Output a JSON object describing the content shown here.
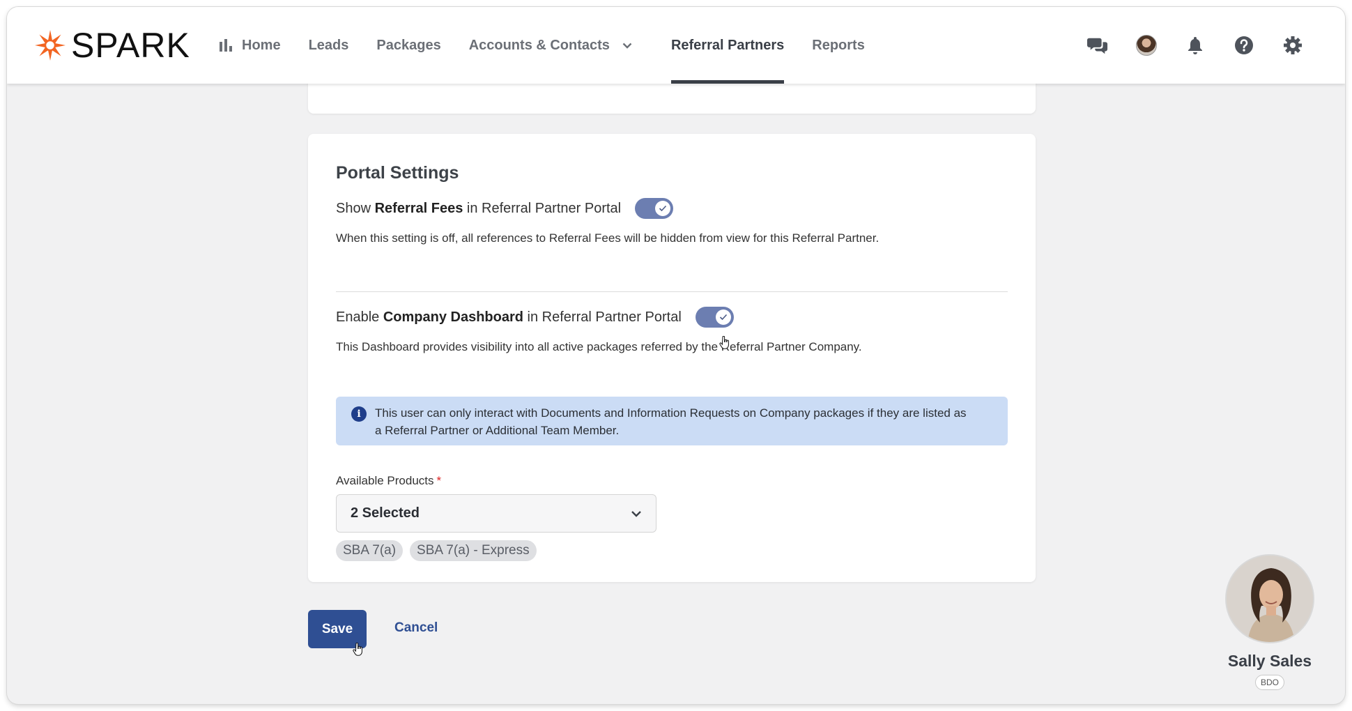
{
  "brand": {
    "name": "SPARK",
    "logo_color": "#f26522"
  },
  "nav": {
    "items": [
      {
        "label": "Home",
        "icon": "bar-chart-icon"
      },
      {
        "label": "Leads"
      },
      {
        "label": "Packages"
      },
      {
        "label": "Accounts & Contacts",
        "dropdown": true
      },
      {
        "label": "Referral Partners",
        "active": true
      },
      {
        "label": "Reports"
      }
    ],
    "right_icons": [
      "chat-icon",
      "user-avatar",
      "bell-icon",
      "help-icon",
      "gear-icon"
    ]
  },
  "portal_settings": {
    "title": "Portal Settings",
    "referral_fees": {
      "prefix": "Show ",
      "bold": "Referral Fees",
      "suffix": " in Referral Partner Portal",
      "enabled": true,
      "description": "When this setting is off, all references to Referral Fees will be hidden from view for this Referral Partner."
    },
    "company_dashboard": {
      "prefix": "Enable ",
      "bold": "Company Dashboard",
      "suffix": " in Referral Partner Portal",
      "enabled": true,
      "description": "This Dashboard provides visibility into all active packages referred by the Referral Partner Company."
    },
    "info": {
      "line1": "This user can only interact with Documents and Information Requests on Company packages if they are listed as",
      "line2": "a Referral Partner or Additional Team Member."
    },
    "available_products": {
      "label": "Available Products",
      "required_mark": "*",
      "value": "2 Selected",
      "chips": [
        "SBA 7(a)",
        "SBA 7(a) - Express"
      ]
    }
  },
  "actions": {
    "save": "Save",
    "cancel": "Cancel"
  },
  "profile": {
    "name": "Sally Sales",
    "badge": "BDO"
  },
  "colors": {
    "primary": "#2f4f93",
    "toggle_on": "#6c7eb1",
    "info_bg": "#cbdcf5",
    "page_bg": "#f1f1f2"
  }
}
